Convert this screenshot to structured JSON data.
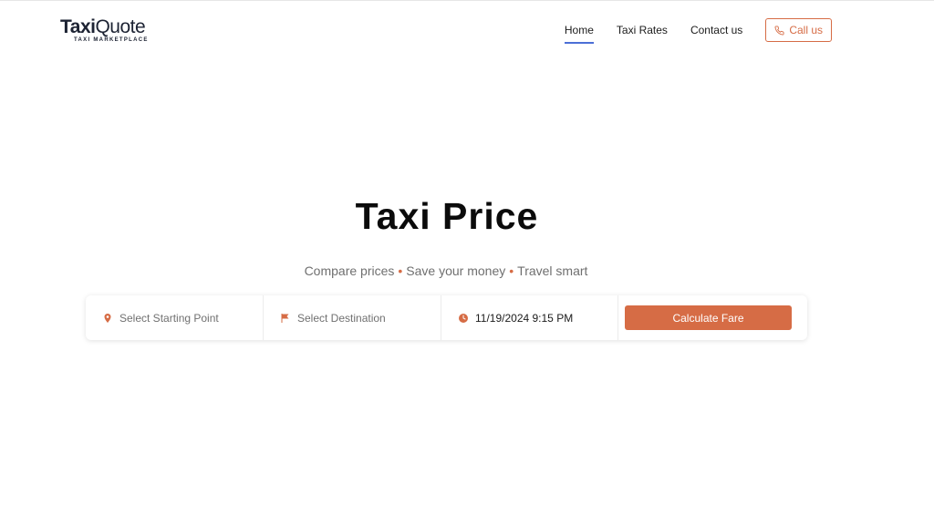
{
  "logo": {
    "part1": "Taxi",
    "part2": "Quote",
    "tagline": "TAXI MARKETPLACE"
  },
  "nav": {
    "items": [
      {
        "label": "Home",
        "active": true
      },
      {
        "label": "Taxi Rates",
        "active": false
      },
      {
        "label": "Contact us",
        "active": false
      }
    ],
    "call_label": "Call us",
    "call_icon": "phone-icon"
  },
  "hero": {
    "title": "Taxi Price",
    "subtitle_parts": [
      "Compare prices",
      "Save your money",
      "Travel smart"
    ],
    "separator": "•"
  },
  "search": {
    "start_placeholder": "Select Starting Point",
    "start_icon": "map-pin-icon",
    "destination_placeholder": "Select Destination",
    "destination_icon": "flag-icon",
    "datetime_value": "11/19/2024 9:15 PM",
    "datetime_icon": "clock-icon",
    "submit_label": "Calculate Fare"
  },
  "colors": {
    "accent": "#d66c45",
    "nav_underline": "#4b6fd6",
    "text": "#1b1b1b",
    "muted": "#6f6f6f"
  }
}
